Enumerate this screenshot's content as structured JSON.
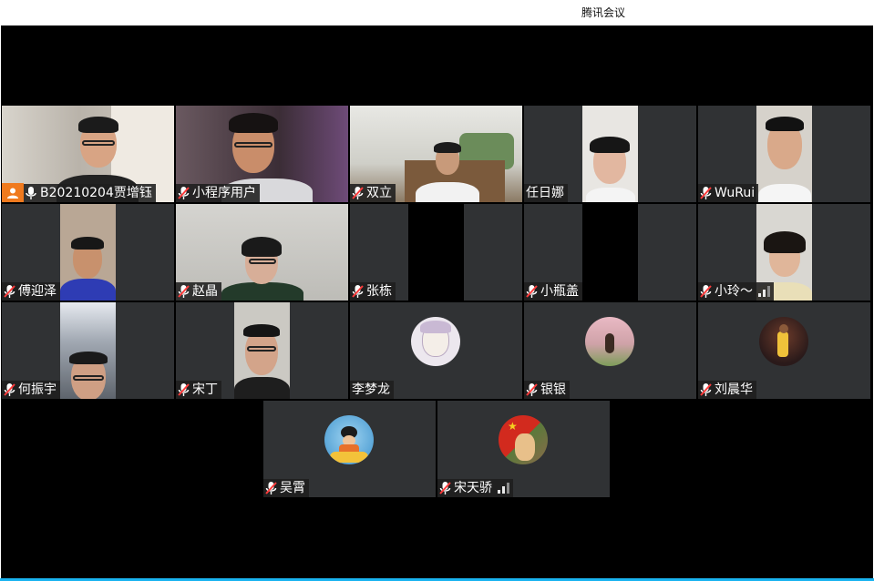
{
  "window": {
    "title": "腾讯会议"
  },
  "colors": {
    "host_badge": "#f07a1e",
    "tile_bg": "#303234",
    "stage_bg": "#000000",
    "muted_mic": "#ff3b3b",
    "accent_line": "#1ab3f0"
  },
  "participants": [
    {
      "name": "B20210204贾增钰",
      "mic": "mic-on-icon",
      "host": true
    },
    {
      "name": "小程序用户",
      "mic": "mic-muted-icon"
    },
    {
      "name": "双立",
      "mic": "mic-muted-icon"
    },
    {
      "name": "任日娜",
      "mic": "none"
    },
    {
      "name": "WuRui",
      "mic": "mic-muted-icon"
    },
    {
      "name": "傅迎泽",
      "mic": "mic-muted-icon"
    },
    {
      "name": "赵晶",
      "mic": "mic-muted-icon"
    },
    {
      "name": "张栋",
      "mic": "mic-muted-icon"
    },
    {
      "name": "小瓶盖",
      "mic": "mic-muted-icon"
    },
    {
      "name": "小玲～",
      "mic": "mic-muted-icon",
      "signal": true
    },
    {
      "name": "何振宇",
      "mic": "mic-muted-icon"
    },
    {
      "name": "宋丁",
      "mic": "mic-muted-icon"
    },
    {
      "name": "李梦龙",
      "mic": "none"
    },
    {
      "name": "银银",
      "mic": "mic-muted-icon"
    },
    {
      "name": "刘晨华",
      "mic": "mic-muted-icon"
    },
    {
      "name": "吴霄",
      "mic": "mic-muted-icon"
    },
    {
      "name": "宋天骄",
      "mic": "mic-muted-icon",
      "signal": true
    }
  ]
}
